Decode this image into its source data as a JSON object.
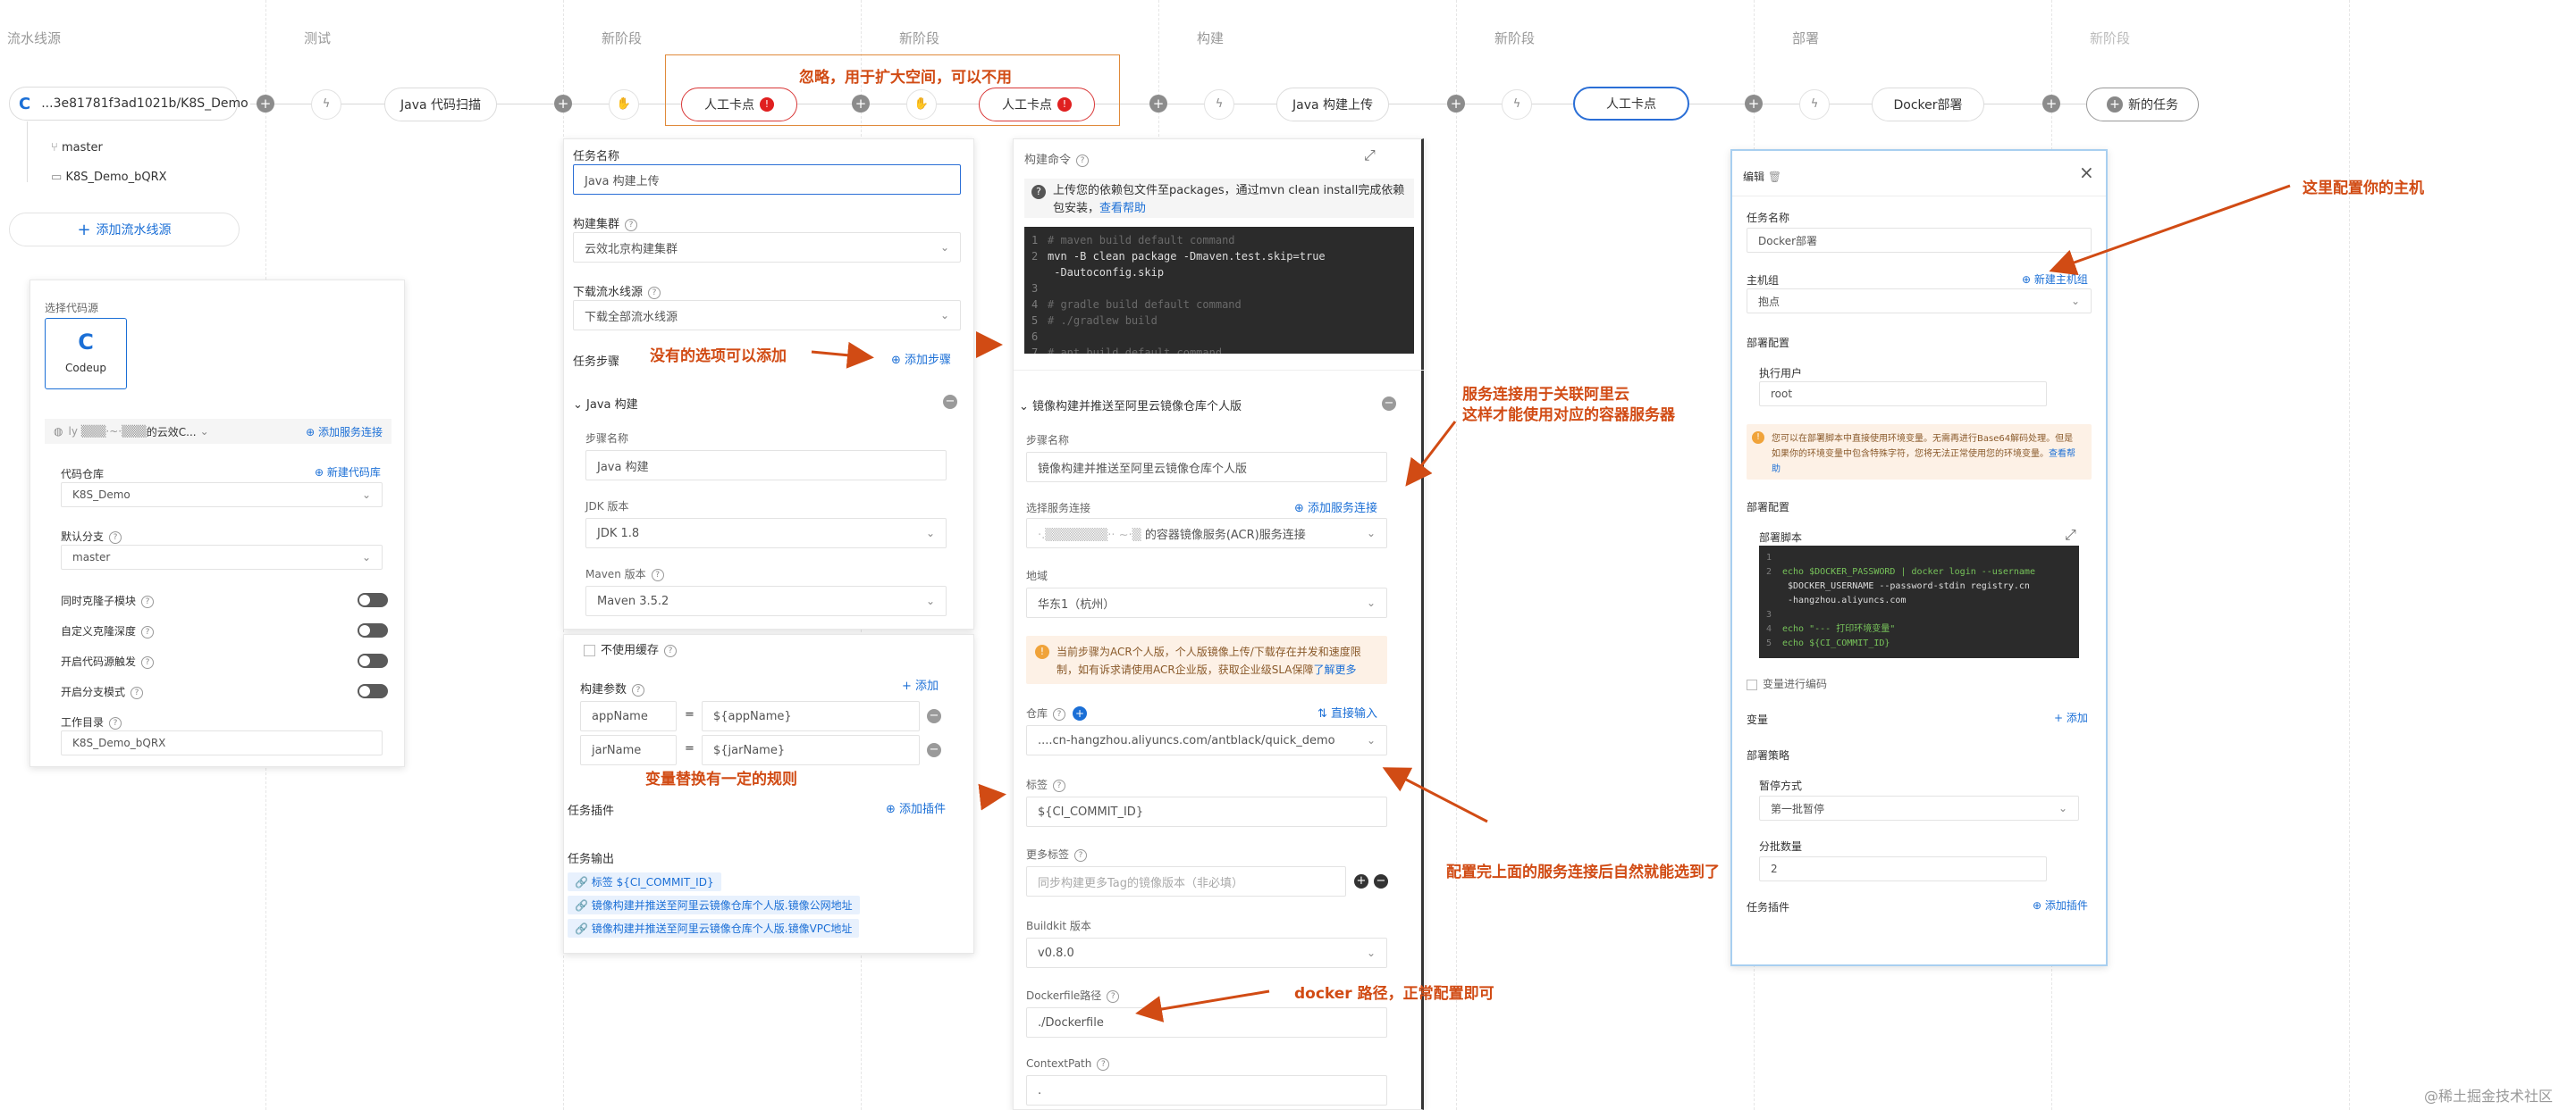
{
  "stages": [
    "流水线源",
    "测试",
    "新阶段",
    "新阶段",
    "构建",
    "新阶段",
    "部署",
    "新阶段"
  ],
  "source": {
    "repo": "...3e81781f3ad1021b/K8S_Demo",
    "branch": "master",
    "name": "K8S_Demo_bQRX",
    "add_source": "添加流水线源"
  },
  "jobs": {
    "scan": "Java 代码扫描",
    "manual1": "人工卡点",
    "manual2": "人工卡点",
    "build": "Java 构建上传",
    "manual3": "人工卡点",
    "deploy": "Docker部署",
    "new_task": "新的任务",
    "badge": "!"
  },
  "codesource": {
    "title": "选择代码源",
    "codeup": "Codeup",
    "account": "的云效C...",
    "add_service": "添加服务连接",
    "repo_label": "代码仓库",
    "new_repo": "新建代码库",
    "repo_value": "K8S_Demo",
    "branch_label": "默认分支",
    "branch_value": "master",
    "opts": [
      "同时克隆子模块",
      "自定义克隆深度",
      "开启代码源触发",
      "开启分支模式"
    ],
    "workdir_label": "工作目录",
    "workdir_value": "K8S_Demo_bQRX"
  },
  "buildtask": {
    "name_label": "任务名称",
    "name_value": "Java 构建上传",
    "cluster_label": "构建集群",
    "cluster_value": "云效北京构建集群",
    "download_label": "下载流水线源",
    "download_value": "下载全部流水线源",
    "steps_label": "任务步骤",
    "add_step": "添加步骤",
    "step_java": "Java 构建",
    "step_name_label": "步骤名称",
    "step_name_value": "Java 构建",
    "jdk_label": "JDK 版本",
    "jdk_value": "JDK 1.8",
    "maven_label": "Maven 版本",
    "maven_value": "Maven 3.5.2",
    "nocache": "不使用缓存",
    "params_label": "构建参数",
    "add": "添加",
    "params": [
      {
        "k": "appName",
        "eq": "=",
        "v": "${appName}"
      },
      {
        "k": "jarName",
        "eq": "=",
        "v": "${jarName}"
      }
    ],
    "plugin_label": "任务插件",
    "add_plugin": "添加插件",
    "output_label": "任务输出",
    "outputs": [
      "标签 ${CI_COMMIT_ID}",
      "镜像构建并推送至阿里云镜像仓库个人版.镜像公网地址",
      "镜像构建并推送至阿里云镜像仓库个人版.镜像VPC地址"
    ]
  },
  "buildcmd": {
    "label": "构建命令",
    "tip": "上传您的依赖包文件至packages，通过mvn clean install完成依赖包安装，",
    "tip_link": "查看帮助",
    "code": [
      {
        "n": "1",
        "t": "# maven build default command",
        "c": "cm"
      },
      {
        "n": "2",
        "t": "mvn -B clean package -Dmaven.test.skip=true",
        "c": ""
      },
      {
        "n": "",
        "t": "   -Dautoconfig.skip",
        "c": ""
      },
      {
        "n": "3",
        "t": "",
        "c": ""
      },
      {
        "n": "4",
        "t": "# gradle build default command",
        "c": "cm"
      },
      {
        "n": "5",
        "t": "# ./gradlew build",
        "c": "cm"
      },
      {
        "n": "6",
        "t": "",
        "c": ""
      },
      {
        "n": "7",
        "t": "# ant build default command",
        "c": "cm"
      }
    ],
    "image_step": "镜像构建并推送至阿里云镜像仓库个人版",
    "step_name_label": "步骤名称",
    "step_name_value": "镜像构建并推送至阿里云镜像仓库个人版",
    "svc_label": "选择服务连接",
    "add_svc": "添加服务连接",
    "svc_value": "的容器镜像服务(ACR)服务连接",
    "region_label": "地域",
    "region_value": "华东1（杭州）",
    "acr_notice": "当前步骤为ACR个人版，个人版镜像上传/下载存在并发和速度限制，如有诉求请使用ACR企业版，获取企业级SLA保障",
    "acr_link": "了解更多",
    "repo_label": "仓库",
    "direct_input": "直接输入",
    "repo_value": "....cn-hangzhou.aliyuncs.com/antblack/quick_demo",
    "tag_label": "标签",
    "tag_value": "${CI_COMMIT_ID}",
    "more_tag_label": "更多标签",
    "more_tag_ph": "同步构建更多Tag的镜像版本（非必填）",
    "buildkit_label": "Buildkit 版本",
    "buildkit_value": "v0.8.0",
    "dockerfile_label": "Dockerfile路径",
    "dockerfile_value": "./Dockerfile",
    "context_label": "ContextPath",
    "context_value": "."
  },
  "deploy": {
    "edit": "编辑",
    "name_label": "任务名称",
    "name_value": "Docker部署",
    "host_label": "主机组",
    "new_host": "新建主机组",
    "host_value": "抱点",
    "deploy_cfg": "部署配置",
    "user_label": "执行用户",
    "user_value": "root",
    "notice": "您可以在部署脚本中直接使用环境变量。无需再进行Base64解码处理。但是如果你的环境变量中包含特殊字符，您将无法正常使用您的环境变量。",
    "notice_link": "查看帮助",
    "deploy_cfg2": "部署配置",
    "script_label": "部署脚本",
    "script": [
      {
        "n": "1",
        "t": ""
      },
      {
        "n": "2",
        "t": "echo $DOCKER_PASSWORD | docker login --username"
      },
      {
        "n": "",
        "t": "   $DOCKER_USERNAME --password-stdin registry.cn"
      },
      {
        "n": "",
        "t": "   -hangzhou.aliyuncs.com"
      },
      {
        "n": "3",
        "t": ""
      },
      {
        "n": "4",
        "t": "echo \"--- 打印环境变量\""
      },
      {
        "n": "5",
        "t": "echo ${CI_COMMIT_ID}"
      }
    ],
    "var_encode": "变量进行编码",
    "var_label": "变量",
    "add": "添加",
    "strategy_label": "部署策略",
    "pause_label": "暂停方式",
    "pause_value": "第一批暂停",
    "batch_label": "分批数量",
    "batch_value": "2",
    "plugin_label": "任务插件",
    "add_plugin": "添加插件"
  },
  "annotations": {
    "ignore": "忽略，用于扩大空间，可以不用",
    "noopt": "没有的选项可以添加",
    "svc1": "服务连接用于关联阿里云",
    "svc2": "这样才能使用对应的容器服务器",
    "var": "变量替换有一定的规则",
    "auto": "配置完上面的服务连接后自然就能选到了",
    "docker": "docker 路径，正常配置即可",
    "host": "这里配置你的主机"
  },
  "watermark": "@稀土掘金技术社区"
}
